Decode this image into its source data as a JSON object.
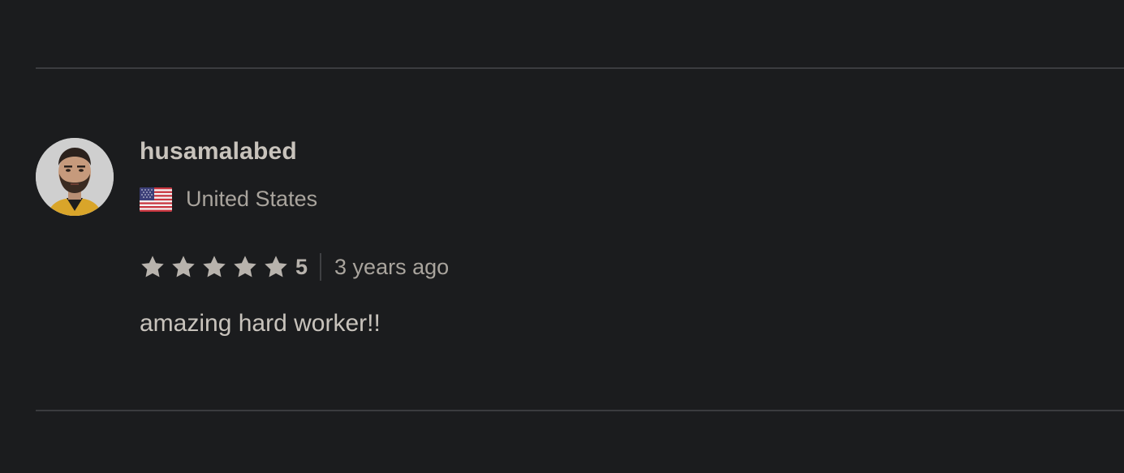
{
  "review": {
    "username": "husamalabed",
    "country": "United States",
    "rating": 5,
    "rating_label": "5",
    "stars_total": 5,
    "time_ago": "3 years ago",
    "comment": "amazing hard worker!!"
  },
  "icons": {
    "avatar": "user-avatar-photo",
    "flag": "us-flag-icon",
    "star": "star-icon"
  },
  "colors": {
    "background": "#1b1c1e",
    "divider": "#3b3c3f",
    "username": "#c8c3bc",
    "secondary_text": "#a9a49d",
    "star": "#b8b3ad"
  }
}
